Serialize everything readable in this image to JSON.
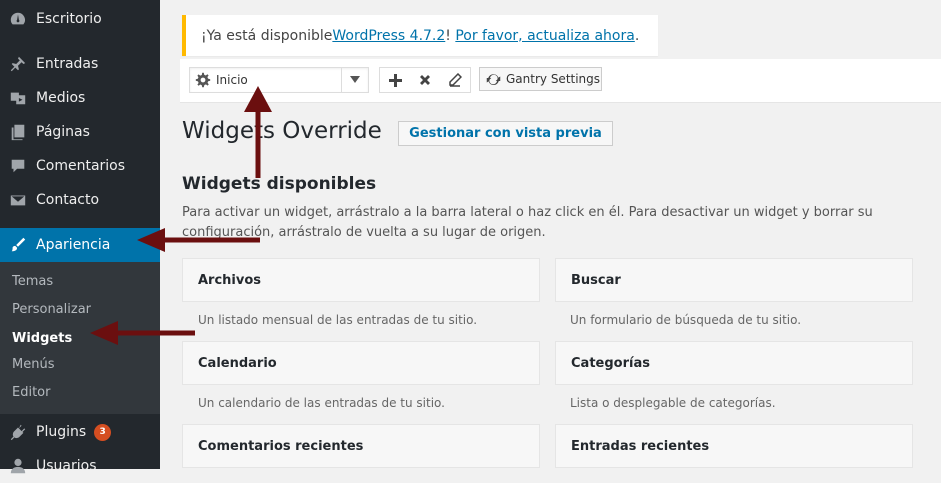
{
  "sidebar": {
    "items": [
      {
        "label": "Escritorio",
        "icon": "dashboard-icon"
      },
      {
        "label": "Entradas",
        "icon": "pin-icon"
      },
      {
        "label": "Medios",
        "icon": "media-icon"
      },
      {
        "label": "Páginas",
        "icon": "pages-icon"
      },
      {
        "label": "Comentarios",
        "icon": "comment-icon"
      },
      {
        "label": "Contacto",
        "icon": "mail-icon"
      },
      {
        "label": "Apariencia",
        "icon": "brush-icon"
      },
      {
        "label": "Plugins",
        "icon": "plugin-icon",
        "badge": "3"
      },
      {
        "label": "Usuarios",
        "icon": "user-icon"
      }
    ],
    "submenu": [
      "Temas",
      "Personalizar",
      "Widgets",
      "Menús",
      "Editor"
    ]
  },
  "notice": {
    "prefix": "¡Ya está disponible ",
    "link1": "WordPress 4.7.2",
    "middle": "! ",
    "link2": "Por favor, actualiza ahora",
    "suffix": "."
  },
  "toolbar": {
    "select_value": "Inicio",
    "gantry_label": "Gantry Settings"
  },
  "page": {
    "title": "Widgets Override",
    "preview_button": "Gestionar con vista previa",
    "available_title": "Widgets disponibles",
    "available_desc": "Para activar un widget, arrástralo a la barra lateral o haz click en él. Para desactivar un widget y borrar su configuración, arrástralo de vuelta a su lugar de origen."
  },
  "widgets": [
    {
      "name": "Archivos",
      "desc": "Un listado mensual de las entradas de tu sitio."
    },
    {
      "name": "Buscar",
      "desc": "Un formulario de búsqueda de tu sitio."
    },
    {
      "name": "Calendario",
      "desc": "Un calendario de las entradas de tu sitio."
    },
    {
      "name": "Categorías",
      "desc": "Lista o desplegable de categorías."
    },
    {
      "name": "Comentarios recientes",
      "desc": ""
    },
    {
      "name": "Entradas recientes",
      "desc": ""
    }
  ],
  "colors": {
    "sidebar_bg": "#23282d",
    "active_menu": "#0073aa",
    "submenu_bg": "#32373c",
    "notice_border": "#ffb900",
    "link": "#0073aa",
    "badge": "#d54e21",
    "annotation_arrow": "#6b0f0f"
  }
}
